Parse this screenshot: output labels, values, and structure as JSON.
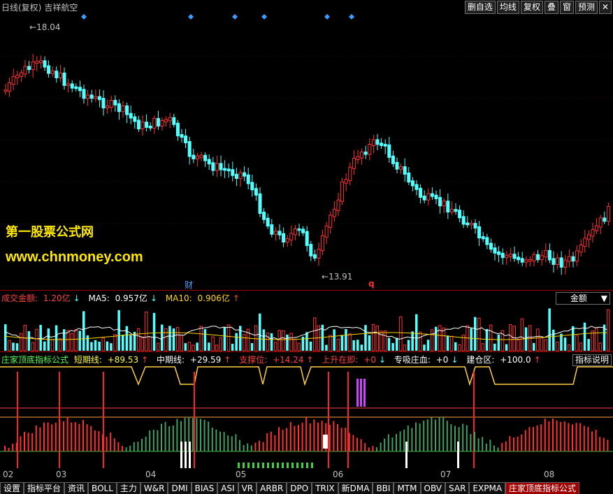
{
  "header": {
    "title": "日线(复权)",
    "stock_name": "吉祥航空",
    "buttons": [
      "删自选",
      "均线",
      "复权",
      "叠",
      "窗",
      "预测"
    ],
    "close_icon": "close-icon"
  },
  "main_chart": {
    "high_label": "18.04",
    "low_label": "13.91",
    "finance_marker": "财",
    "q_marker": "q",
    "watermark_line1": "第一股票公式网",
    "watermark_line2": "www.chnmoney.com",
    "colors": {
      "up": "#ff3232",
      "down": "#54ffff",
      "marker": "#3d9bff"
    }
  },
  "volume_pane": {
    "label": "成交金额:",
    "value": "1.20亿",
    "arrow": "↓",
    "ma5_label": "MA5:",
    "ma5_value": "0.957亿",
    "ma5_arrow": "↓",
    "ma10_label": "MA10:",
    "ma10_value": "0.906亿",
    "ma10_arrow": "↑",
    "selector": "金额"
  },
  "indicator_pane": {
    "name": "庄家顶底指标公式",
    "items": [
      {
        "label": "短期线:",
        "value": "+89.53",
        "arrow": "↑"
      },
      {
        "label": "中期线:",
        "value": "+29.59",
        "arrow": "↑"
      },
      {
        "label": "支撑位:",
        "value": "+14.24",
        "arrow": "↑"
      },
      {
        "label": "上升在即:",
        "value": "+0",
        "arrow": "↓"
      },
      {
        "label": "专吸庄血:",
        "value": "+0",
        "arrow": "↓"
      },
      {
        "label": "建仓区:",
        "value": "+100.0",
        "arrow": "↑"
      }
    ],
    "description_button": "指标说明"
  },
  "x_axis": [
    "02",
    "03",
    "04",
    "05",
    "06",
    "07",
    "08"
  ],
  "tabs": [
    "设置",
    "指标平台",
    "资讯",
    "BOLL",
    "主力",
    "W&R",
    "DMI",
    "BIAS",
    "ASI",
    "VR",
    "ARBR",
    "DPO",
    "TRIX",
    "新DMA",
    "BBI",
    "MTM",
    "OBV",
    "SAR",
    "EXPMA",
    "庄家顶底指标公式"
  ],
  "active_tab": "庄家顶底指标公式"
}
